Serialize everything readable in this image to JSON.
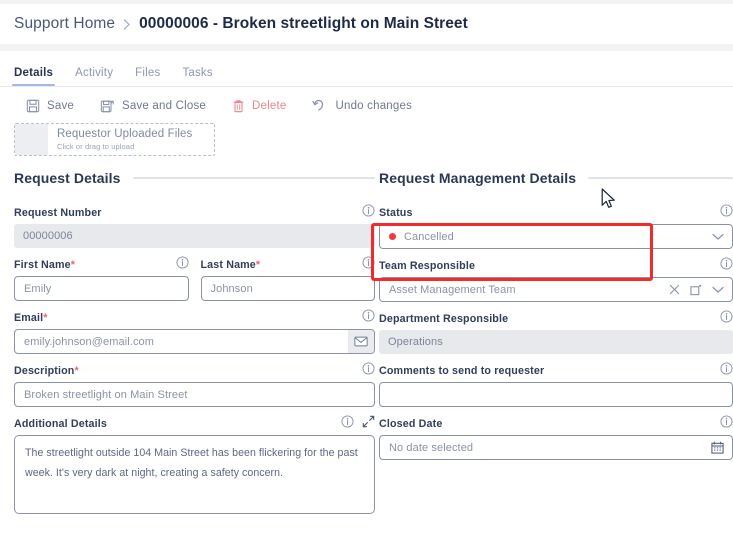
{
  "breadcrumb": {
    "home_label": "Support Home",
    "separator": "›",
    "current_label": "00000006 - Broken streetlight on Main Street"
  },
  "tabs": [
    {
      "label": "Details",
      "active": true
    },
    {
      "label": "Activity",
      "active": false
    },
    {
      "label": "Files",
      "active": false
    },
    {
      "label": "Tasks",
      "active": false
    }
  ],
  "toolbar": {
    "save_label": "Save",
    "save_close_label": "Save and Close",
    "delete_label": "Delete",
    "undo_label": "Undo changes",
    "delete_color": "#e8858a"
  },
  "upload": {
    "title": "Requestor Uploaded Files",
    "subtitle": "Click or drag to upload"
  },
  "left_section": {
    "title": "Request Details",
    "request_number": {
      "label": "Request Number",
      "value": "00000006",
      "readonly": true
    },
    "first_name": {
      "label": "First Name",
      "required": "*",
      "value": "Emily"
    },
    "last_name": {
      "label": "Last Name",
      "required": "*",
      "value": "Johnson"
    },
    "email": {
      "label": "Email",
      "required": "*",
      "value": "emily.johnson@email.com"
    },
    "description": {
      "label": "Description",
      "required": "*",
      "value": "Broken streetlight on Main Street"
    },
    "additional_details": {
      "label": "Additional Details",
      "value": "The streetlight outside 104 Main Street has been flickering for the past week. It's very dark at night, creating a safety concern."
    }
  },
  "right_section": {
    "title": "Request Management Details",
    "status": {
      "label": "Status",
      "value": "Cancelled",
      "dot_color": "#ef3b3b",
      "highlighted": true,
      "highlight_color": "#f42a2a"
    },
    "team_responsible": {
      "label": "Team Responsible",
      "value": "Asset Management Team"
    },
    "department_responsible": {
      "label": "Department Responsible",
      "value": "Operations",
      "readonly": true
    },
    "comments": {
      "label": "Comments to send to requester",
      "value": "",
      "placeholder": ""
    },
    "closed_date": {
      "label": "Closed Date",
      "placeholder": "No date selected",
      "value": ""
    }
  }
}
